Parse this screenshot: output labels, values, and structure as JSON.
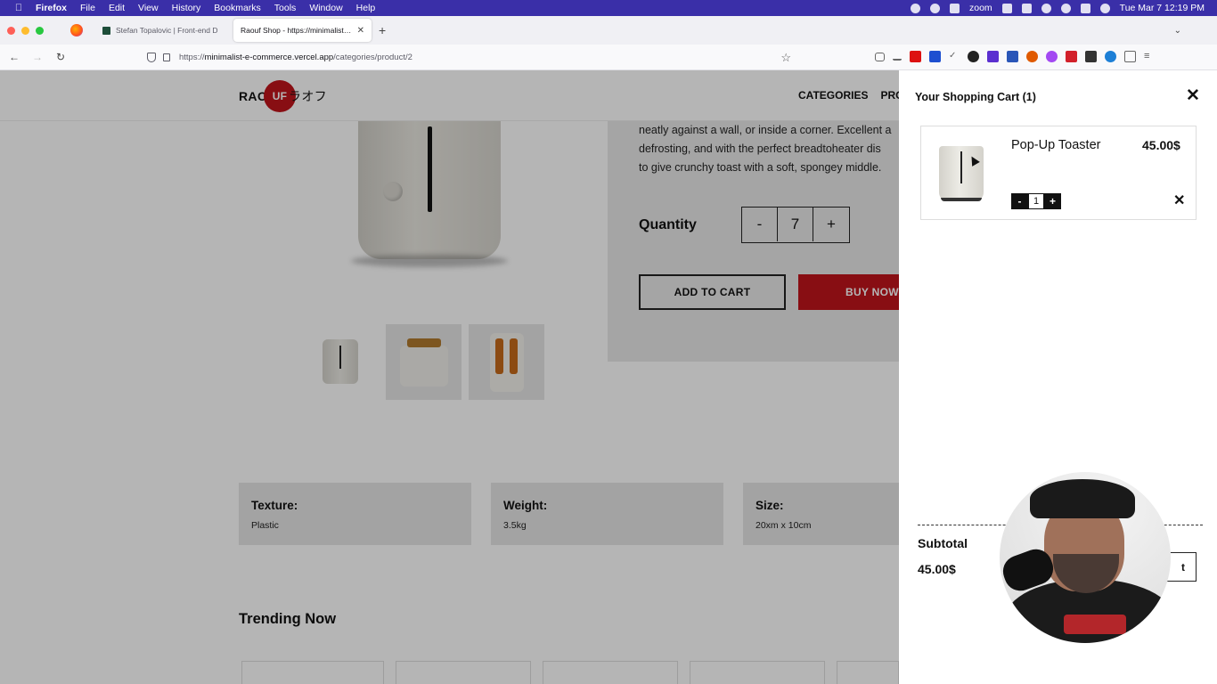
{
  "menubar": {
    "app_name": "Firefox",
    "items": [
      "File",
      "Edit",
      "View",
      "History",
      "Bookmarks",
      "Tools",
      "Window",
      "Help"
    ],
    "zoom_label": "zoom",
    "datetime": "Tue Mar 7  12:19 PM"
  },
  "browser": {
    "tabs": [
      {
        "title": "Stefan Topalovic | Front-end D"
      },
      {
        "title": "Raouf Shop - https://minimalist-e-c"
      }
    ],
    "url_prefix": "https://",
    "url_domain": "minimalist-e-commerce.vercel.app",
    "url_path": "/categories/product/2"
  },
  "site": {
    "logo_left": "RAO",
    "logo_circle": "UF",
    "logo_jp": "ラオフ",
    "nav": [
      "CATEGORIES",
      "PROD"
    ]
  },
  "product": {
    "description": "neatly against a wall, or inside a corner. Excellent a\ndefrosting, and with the perfect breadtoheater dis\nto give crunchy toast with a soft, spongey middle.",
    "quantity_label": "Quantity",
    "qty_minus": "-",
    "qty_value": "7",
    "qty_plus": "+",
    "add_to_cart": "ADD TO CART",
    "buy_now": "BUY NOW",
    "specs": [
      {
        "label": "Texture:",
        "value": "Plastic"
      },
      {
        "label": "Weight:",
        "value": "3.5kg"
      },
      {
        "label": "Size:",
        "value": "20xm x 10cm"
      }
    ],
    "trending_title": "Trending Now"
  },
  "cart": {
    "title": "Your Shopping Cart (1)",
    "close": "✕",
    "item": {
      "name": "Pop-Up Toaster",
      "price": "45.00$",
      "minus": "-",
      "qty": "1",
      "plus": "+",
      "remove": "✕"
    },
    "subtotal_label": "Subtotal",
    "subtotal_value": "45.00$",
    "checkout_partial": "t"
  },
  "colors": {
    "accent_red": "#c0141b",
    "menubar": "#3a2fa8"
  }
}
